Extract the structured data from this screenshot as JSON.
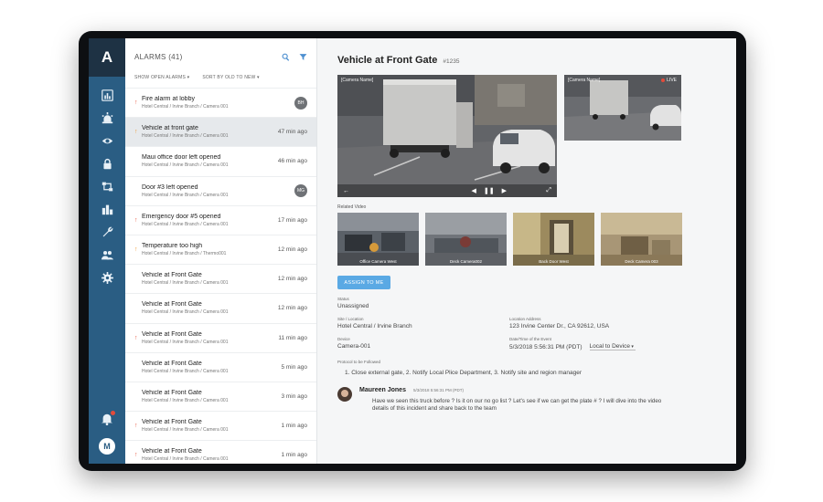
{
  "rail": {
    "logo": "A",
    "icons": [
      "chart-icon",
      "alarm-light-icon",
      "eye-icon",
      "lock-icon",
      "workflow-icon",
      "buildings-icon",
      "wrench-icon",
      "people-icon",
      "gear-icon"
    ],
    "user_initial": "M"
  },
  "alarms": {
    "title": "ALARMS (41)",
    "filter_open": "SHOW OPEN ALARMS",
    "filter_sort": "SORT BY OLD TO NEW",
    "items": [
      {
        "title": "Fire alarm at lobby",
        "location": "Hotel Central / Irvine Branch / Camera 001",
        "time": "",
        "badge": "BH",
        "priority": "high"
      },
      {
        "title": "Vehicle at front gate",
        "location": "Hotel Central / Irvine Branch / Camera 001",
        "time": "47 min ago",
        "badge": "",
        "priority": "medium",
        "selected": true
      },
      {
        "title": "Maui office door left opened",
        "location": "Hotel Central / Irvine Branch / Camera 001",
        "time": "46 min ago",
        "badge": "",
        "priority": "none"
      },
      {
        "title": "Door #3 left opened",
        "location": "Hotel Central / Irvine Branch / Camera 001",
        "time": "",
        "badge": "MG",
        "priority": "none"
      },
      {
        "title": "Emergency door #5 opened",
        "location": "Hotel Central / Irvine Branch / Camera 001",
        "time": "17 min ago",
        "badge": "",
        "priority": "high"
      },
      {
        "title": "Temperature too high",
        "location": "Hotel Central / Irvine Branch / Thermo001",
        "time": "12 min ago",
        "badge": "",
        "priority": "medium"
      },
      {
        "title": "Vehicle at Front Gate",
        "location": "Hotel Central / Irvine Branch / Camera 001",
        "time": "12 min ago",
        "badge": "",
        "priority": "none"
      },
      {
        "title": "Vehicle at Front Gate",
        "location": "Hotel Central / Irvine Branch / Camera 001",
        "time": "12 min ago",
        "badge": "",
        "priority": "none"
      },
      {
        "title": "Vehicle at Front Gate",
        "location": "Hotel Central / Irvine Branch / Camera 001",
        "time": "11 min ago",
        "badge": "",
        "priority": "high"
      },
      {
        "title": "Vehicle at Front Gate",
        "location": "Hotel Central / Irvine Branch / Camera 001",
        "time": "5 min ago",
        "badge": "",
        "priority": "none"
      },
      {
        "title": "Vehicle at Front Gate",
        "location": "Hotel Central / Irvine Branch / Camera 001",
        "time": "3 min ago",
        "badge": "",
        "priority": "none"
      },
      {
        "title": "Vehicle at Front Gate",
        "location": "Hotel Central / Irvine Branch / Camera 001",
        "time": "1 min ago",
        "badge": "",
        "priority": "high"
      },
      {
        "title": "Vehicle at Front Gate",
        "location": "Hotel Central / Irvine Branch / Camera 001",
        "time": "1 min ago",
        "badge": "",
        "priority": "high"
      }
    ]
  },
  "detail": {
    "title": "Vehicle at Front Gate",
    "id": "#1235",
    "main_camera_label": "[Camera Name]",
    "side_camera_label": "[Camera Name]",
    "live_label": "LIVE",
    "related_label": "Related Video",
    "related": [
      {
        "label": "Office Camera West"
      },
      {
        "label": "Deck Camera002"
      },
      {
        "label": "Back Door West"
      },
      {
        "label": "Deck Camera 003"
      }
    ],
    "assign_button": "ASSIGN TO ME",
    "status_label": "Status",
    "status_value": "Unassigned",
    "site_label": "Site / Location",
    "site_value": "Hotel Central / Irvine Branch",
    "address_label": "Location Address",
    "address_value": "123 Irvine Center Dr., CA 92612, USA",
    "device_label": "Device",
    "device_value": "Camera-001",
    "datetime_label": "Date/Time of the Event",
    "datetime_value": "5/3/2018 5:56:31 PM (PDT)",
    "timezone_value": "Local to Device",
    "protocol_label": "Protocol to be Followed",
    "protocol_text": "1. Close external gate, 2. Notify Local Plice Department, 3. Notify site and region manager",
    "comment": {
      "name": "Maureen Jones",
      "time": "5/3/2018 5:56:31 PM (PDT)",
      "body": "Have we seen this truck before ? Is it on our no go list ? Let's see if we can get the plate # ? I will dive into the video details of this incident and share back to the team"
    }
  }
}
